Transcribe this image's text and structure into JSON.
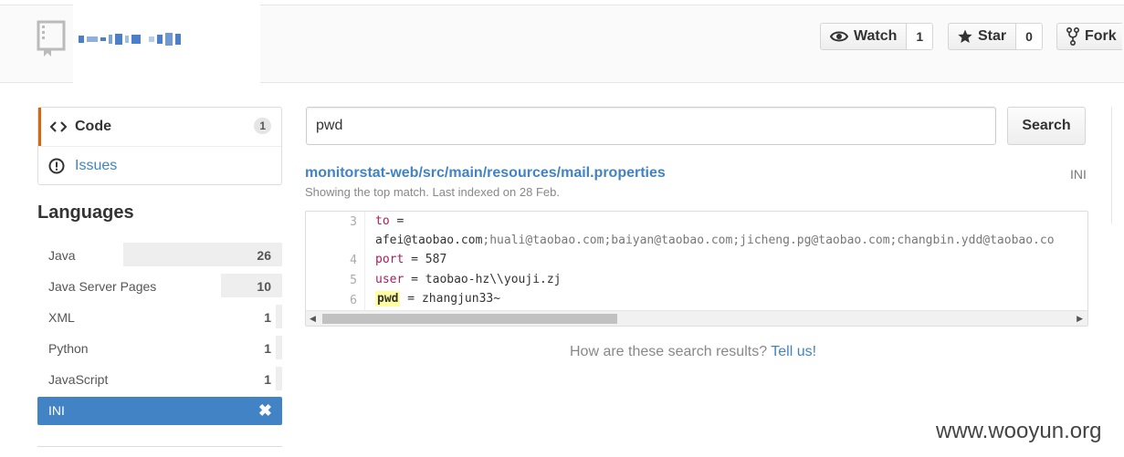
{
  "header": {
    "watch_label": "Watch",
    "watch_count": "1",
    "star_label": "Star",
    "star_count": "0",
    "fork_label": "Fork"
  },
  "nav": {
    "items": [
      {
        "label": "Code",
        "count": "1",
        "icon": "code-icon"
      },
      {
        "label": "Issues",
        "icon": "issue-opened-icon"
      }
    ]
  },
  "languages": {
    "heading": "Languages",
    "items": [
      {
        "name": "Java",
        "count": 26
      },
      {
        "name": "Java Server Pages",
        "count": 10
      },
      {
        "name": "XML",
        "count": 1
      },
      {
        "name": "Python",
        "count": 1
      },
      {
        "name": "JavaScript",
        "count": 1
      },
      {
        "name": "INI",
        "selected": true
      }
    ]
  },
  "search": {
    "query": "pwd",
    "button_label": "Search"
  },
  "result": {
    "path": "monitorstat-web/src/main/resources/mail.properties",
    "language": "INI",
    "meta": "Showing the top match. Last indexed on 28 Feb.",
    "lines": [
      {
        "num": "3",
        "key": "to",
        "rest": " =",
        "cont": "afei@taobao.com;huali@taobao.com;baiyan@taobao.com;jicheng.pg@taobao.com;changbin.ydd@taobao.co"
      },
      {
        "num": "4",
        "key": "port",
        "rest": " = 587"
      },
      {
        "num": "5",
        "key": "user",
        "rest": " = taobao-hz\\\\youji.zj"
      },
      {
        "num": "6",
        "key": "pwd",
        "rest": " = zhangjun33~"
      }
    ]
  },
  "feedback": {
    "question": "How are these search results?",
    "link": "Tell us!"
  },
  "watermark": "www.wooyun.org",
  "colors": {
    "accent": "#4183c4",
    "selected_tab_border": "#d26911",
    "highlight": "#ffffa0"
  }
}
